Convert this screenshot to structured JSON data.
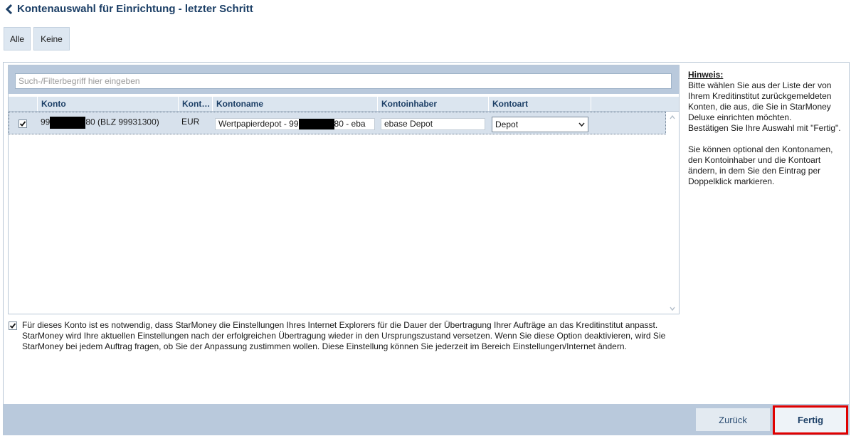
{
  "header": {
    "title": "Kontenauswahl für Einrichtung - letzter Schritt",
    "back_icon": "chevron-left-icon"
  },
  "selection": {
    "all_label": "Alle",
    "none_label": "Keine"
  },
  "filter": {
    "placeholder": "Such-/Filterbegriff hier eingeben",
    "value": ""
  },
  "table": {
    "columns": [
      "Konto",
      "Kont…",
      "Kontoname",
      "Kontoinhaber",
      "Kontoart"
    ],
    "rows": [
      {
        "checked": true,
        "konto_prefix": "99",
        "konto_suffix": "80 (BLZ 99931300)",
        "currency": "EUR",
        "kontoname_prefix": "Wertpapierdepot - 99",
        "kontoname_suffix": "80 - eba",
        "kontoinhaber": "ebase Depot",
        "kontoart": "Depot"
      }
    ]
  },
  "hint": {
    "title": "Hinweis:",
    "text": "Bitte wählen Sie aus der Liste der von Ihrem Kreditinstitut zurückgemeldeten Konten, die aus, die Sie in StarMoney Deluxe einrichten möchten.\nBestätigen Sie Ihre Auswahl mit \"Fertig\".\n\nSie können optional den Kontonamen, den Kontoinhaber und die Kontoart ändern, in dem Sie den Eintrag per Doppelklick markieren."
  },
  "option": {
    "checked": true,
    "text": "Für dieses Konto ist es notwendig, dass StarMoney die Einstellungen Ihres Internet Explorers für die Dauer der Übertragung Ihrer Aufträge an das Kreditinstitut anpasst. StarMoney wird Ihre aktuellen Einstellungen nach der erfolgreichen Übertragung wieder in den Ursprungszustand versetzen. Wenn Sie diese Option deaktivieren, wird Sie StarMoney bei jedem Auftrag fragen, ob Sie der Anpassung zustimmen wollen. Diese Einstellung können Sie jederzeit im Bereich Einstellungen/Internet ändern."
  },
  "footer": {
    "back_label": "Zurück",
    "finish_label": "Fertig"
  },
  "colors": {
    "accent_blue": "#1c3f66",
    "highlight_red": "#e00000",
    "panel_blue": "#b9c9dc"
  }
}
